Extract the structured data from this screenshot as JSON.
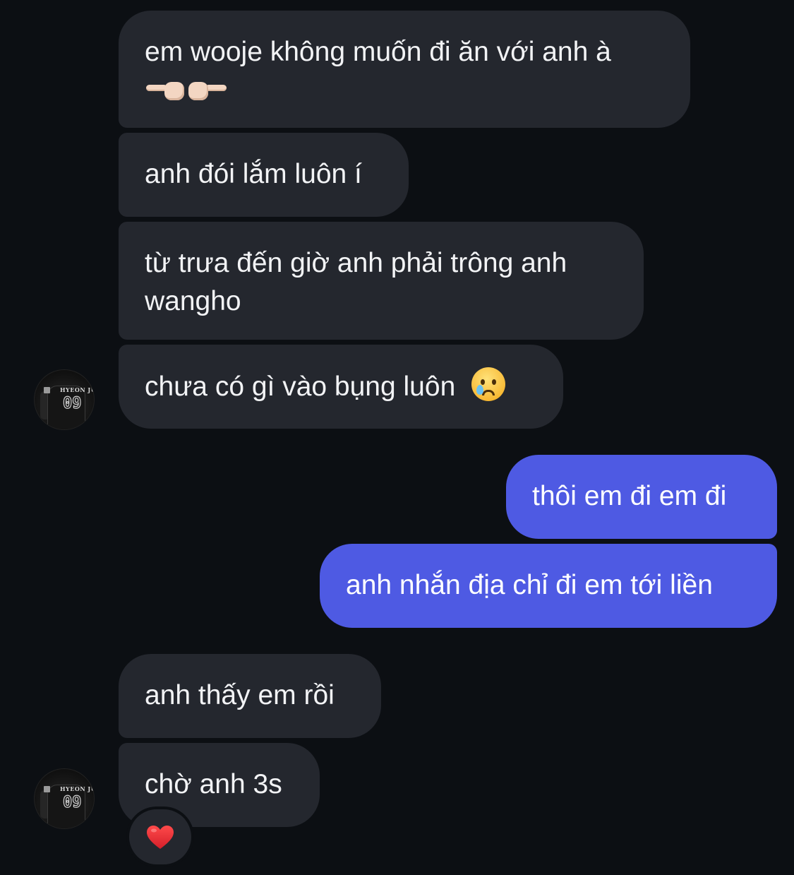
{
  "messages": [
    {
      "id": "b1",
      "direction": "incoming",
      "text": "em wooje không muốn đi ăn với anh à",
      "emoji": "👉🏻👈🏻"
    },
    {
      "id": "b2",
      "direction": "incoming",
      "text": "anh đói lắm luôn í"
    },
    {
      "id": "b3",
      "direction": "incoming",
      "text": "từ trưa đến giờ anh phải trông anh wangho"
    },
    {
      "id": "b4",
      "direction": "incoming",
      "text": "chưa có gì vào bụng luôn",
      "emoji": "😢"
    },
    {
      "id": "b5",
      "direction": "outgoing",
      "text": "thôi em đi em đi"
    },
    {
      "id": "b6",
      "direction": "outgoing",
      "text": "anh nhắn địa chỉ đi em tới liền"
    },
    {
      "id": "b7",
      "direction": "incoming",
      "text": "anh thấy em rồi"
    },
    {
      "id": "b8",
      "direction": "incoming",
      "text": "chờ anh 3s",
      "reaction": "❤️"
    }
  ],
  "avatar": {
    "shirt_name": "HYEON JUN",
    "shirt_number": "09"
  },
  "colors": {
    "background": "#0c0f13",
    "incoming_bubble": "#24272e",
    "outgoing_bubble": "#4e5ae3",
    "text": "#f2f3f5"
  }
}
